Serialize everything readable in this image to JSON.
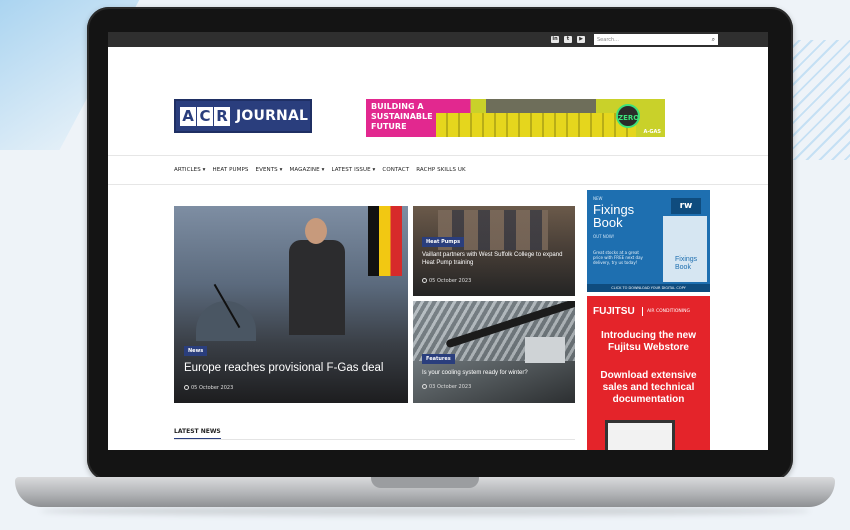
{
  "topbar": {
    "social": [
      "in",
      "t",
      "▶"
    ],
    "search_placeholder": "Search..."
  },
  "logo": {
    "acr": [
      "A",
      "C",
      "R"
    ],
    "journal": "JOURNAL"
  },
  "banner": {
    "line1": "BUILDING A",
    "line2": "SUSTAINABLE",
    "line3": "FUTURE",
    "badge": "ZERO",
    "brand": "A-GAS"
  },
  "nav": {
    "items": [
      "ARTICLES ▾",
      "HEAT PUMPS",
      "EVENTS ▾",
      "MAGAZINE ▾",
      "LATEST ISSUE ▾",
      "CONTACT",
      "RACHP SKILLS UK"
    ]
  },
  "articles": [
    {
      "tag": "News",
      "title": "Europe reaches provisional F-Gas deal",
      "date": "05 October 2023"
    },
    {
      "tag": "Heat Pumps",
      "title": "Vaillant partners with West Suffolk College to expand Heat Pump training",
      "date": "05 October 2023"
    },
    {
      "tag": "Features",
      "title": "Is your cooling system ready for winter?",
      "date": "03 October 2023"
    }
  ],
  "latest_news": "LATEST NEWS",
  "ad_fixings": {
    "small": "NEW",
    "big1": "Fixings",
    "big2": "Book",
    "order": "OUT NOW!",
    "desc": "Great stocks at a great price with FREE next day delivery, try us today!",
    "rw": "rw",
    "book_line1": "Fixings",
    "book_line2": "Book",
    "strip": "CLICK TO DOWNLOAD YOUR DIGITAL COPY"
  },
  "ad_fujitsu": {
    "brand": "FUJITSU",
    "category": "AIR CONDITIONING",
    "headline": "Introducing the new Fujitsu Webstore",
    "sub": "Download extensive sales and technical documentation"
  }
}
